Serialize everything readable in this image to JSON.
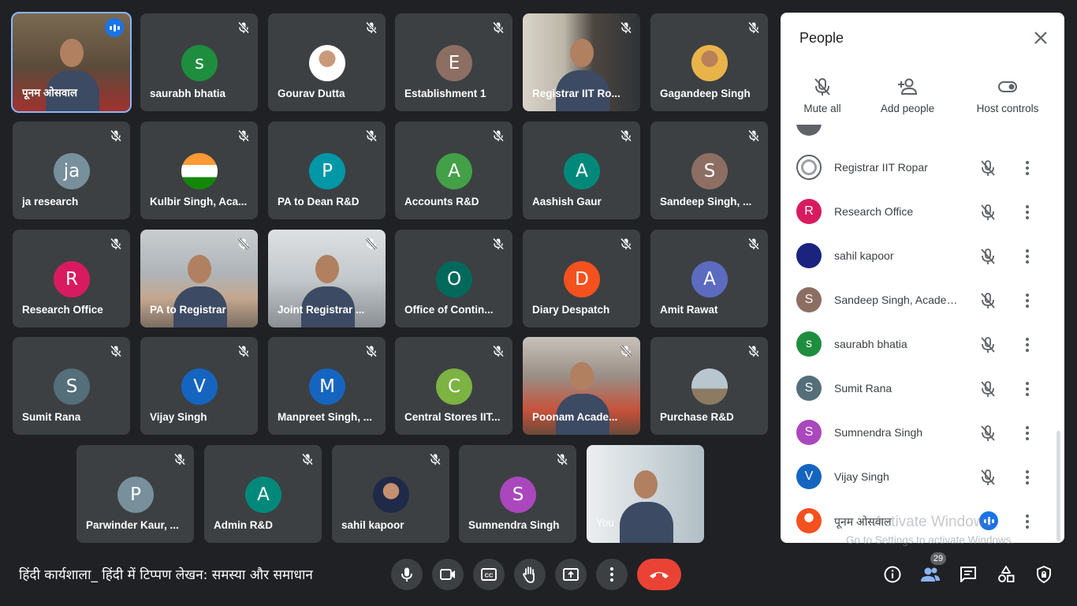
{
  "tiles": [
    {
      "name": "पूनम ओसवाल",
      "video": true
    },
    {
      "name": "saurabh bhatia",
      "initial": "s",
      "color": "#1e8e3e"
    },
    {
      "name": "Gourav Dutta",
      "photo": true
    },
    {
      "name": "Establishment 1",
      "initial": "E",
      "color": "#8d6e63"
    },
    {
      "name": "Registrar IIT Ro...",
      "video": true
    },
    {
      "name": "Gagandeep Singh",
      "photo": true
    },
    {
      "name": "ja research",
      "initial": "ja",
      "color": "#78909c"
    },
    {
      "name": "Kulbir Singh, Aca...",
      "photo": true
    },
    {
      "name": "PA to Dean R&D",
      "initial": "P",
      "color": "#0097a7"
    },
    {
      "name": "Accounts R&D",
      "initial": "A",
      "color": "#43a047"
    },
    {
      "name": "Aashish Gaur",
      "initial": "A",
      "color": "#00897b"
    },
    {
      "name": "Sandeep Singh, ...",
      "initial": "S",
      "color": "#8d6e63"
    },
    {
      "name": "Research Office",
      "initial": "R",
      "color": "#d81b60"
    },
    {
      "name": "PA to Registrar",
      "video": true
    },
    {
      "name": "Joint Registrar ...",
      "video": true
    },
    {
      "name": "Office of Contin...",
      "initial": "O",
      "color": "#00695c"
    },
    {
      "name": "Diary Despatch",
      "initial": "D",
      "color": "#f4511e"
    },
    {
      "name": "Amit Rawat",
      "initial": "A",
      "color": "#5c6bc0"
    },
    {
      "name": "Sumit Rana",
      "initial": "S",
      "color": "#546e7a"
    },
    {
      "name": "Vijay Singh",
      "initial": "V",
      "color": "#1565c0"
    },
    {
      "name": "Manpreet Singh, ...",
      "initial": "M",
      "color": "#1565c0"
    },
    {
      "name": "Central Stores IIT...",
      "initial": "C",
      "color": "#7cb342"
    },
    {
      "name": "Poonam Acade...",
      "video": true
    },
    {
      "name": "Purchase R&D",
      "photo": true
    },
    {
      "name": "Parwinder Kaur, ...",
      "initial": "P",
      "color": "#78909c"
    },
    {
      "name": "Admin R&D",
      "initial": "A",
      "color": "#00897b"
    },
    {
      "name": "sahil kapoor",
      "photo": true
    },
    {
      "name": "Sumnendra Singh",
      "initial": "S",
      "color": "#ab47bc"
    },
    {
      "name": "You",
      "video": true
    }
  ],
  "panel": {
    "title": "People",
    "actions": {
      "mute_all": "Mute all",
      "add_people": "Add people",
      "host_controls": "Host controls"
    },
    "participants": [
      {
        "name": "Registrar IIT Ropar",
        "initial": "",
        "color": "#e8eaed"
      },
      {
        "name": "Research Office",
        "initial": "R",
        "color": "#d81b60"
      },
      {
        "name": "sahil kapoor",
        "initial": "",
        "color": "#1a237e"
      },
      {
        "name": "Sandeep Singh, Academi...",
        "initial": "S",
        "color": "#8d6e63"
      },
      {
        "name": "saurabh bhatia",
        "initial": "s",
        "color": "#1e8e3e"
      },
      {
        "name": "Sumit Rana",
        "initial": "S",
        "color": "#546e7a"
      },
      {
        "name": "Sumnendra Singh",
        "initial": "S",
        "color": "#ab47bc"
      },
      {
        "name": "Vijay Singh",
        "initial": "V",
        "color": "#1565c0"
      },
      {
        "name": "पूनम ओसवाल",
        "initial": "",
        "color": "#f4511e"
      }
    ],
    "watermark_line1": "Activate Windows",
    "watermark_line2": "Go to Settings to activate Windows."
  },
  "bottom": {
    "meeting_title": "हिंदी कार्यशाला_ हिंदी में टिप्पण लेखन: समस्या और समाधान",
    "people_count": "29"
  }
}
